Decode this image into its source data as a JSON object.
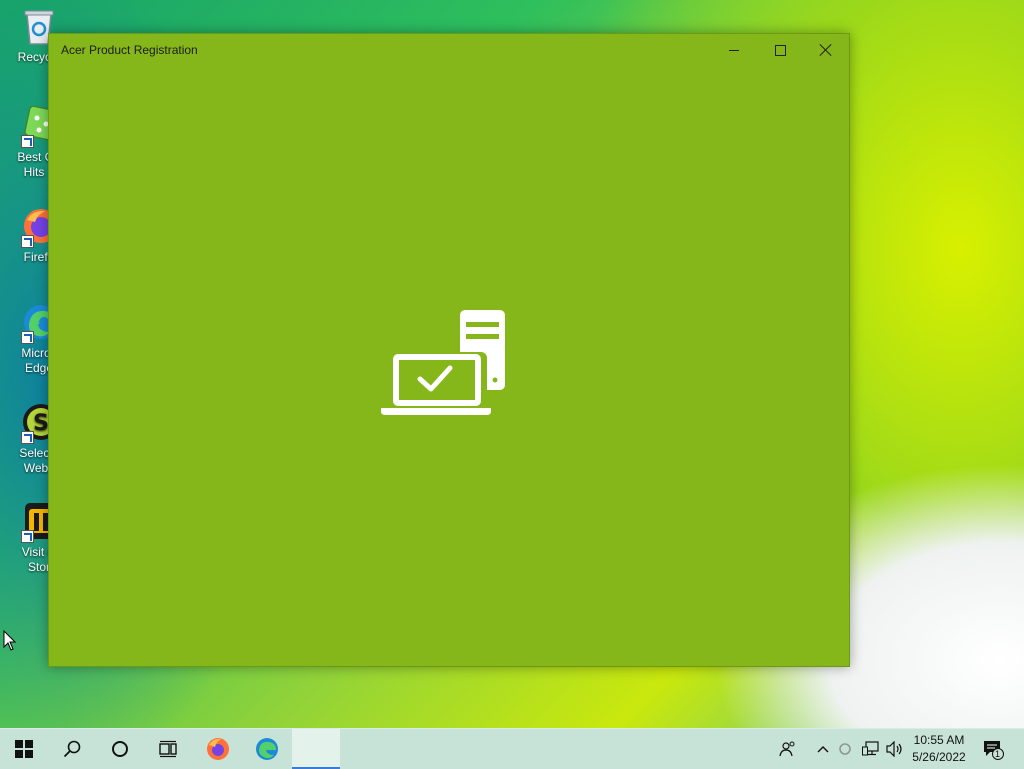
{
  "desktop": {
    "icons": [
      {
        "label": "Recycle",
        "icon": "recycle-bin-icon"
      },
      {
        "label": "Best Ga\nHits 1",
        "icon": "dice-icon"
      },
      {
        "label": "Firefo",
        "icon": "firefox-icon"
      },
      {
        "label": "Micros\nEdge",
        "icon": "edge-icon"
      },
      {
        "label": "Selects\nWebs",
        "icon": "selects-icon"
      },
      {
        "label": "Visit C\nStor",
        "icon": "store-icon"
      }
    ]
  },
  "window": {
    "title": "Acer Product Registration",
    "background": "#86b71a",
    "hero_icon": "laptop-desktop-check-icon"
  },
  "taskbar": {
    "pinned": [
      "start-icon",
      "search-icon",
      "cortana-icon",
      "task-view-icon",
      "firefox-icon",
      "edge-icon",
      "acer-registration-icon"
    ],
    "tray": [
      "people-icon",
      "chevron-up-icon",
      "sync-icon",
      "network-icon",
      "volume-icon"
    ],
    "clock": {
      "time": "10:55 AM",
      "date": "5/26/2022"
    },
    "notifications": {
      "count": "1",
      "icon": "action-center-icon"
    }
  }
}
